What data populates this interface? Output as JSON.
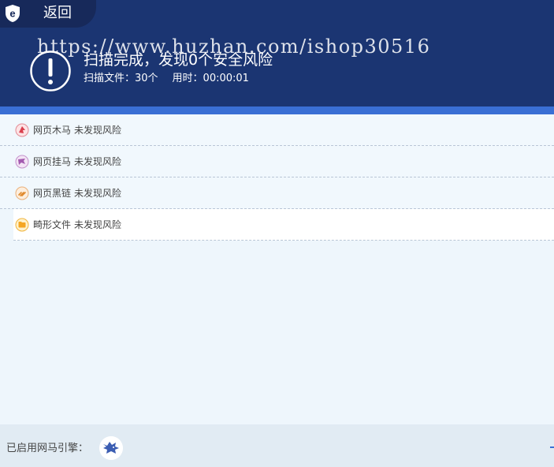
{
  "header": {
    "back_label": "返回",
    "watermark": "https://www.huzhan.com/ishop30516",
    "title": "扫描完成，发现0个安全风险",
    "files_label": "扫描文件：30个",
    "time_label": "用时：00:00:01"
  },
  "results": [
    {
      "name": "网页木马",
      "status": "未发现风险",
      "icon": "trojan-icon"
    },
    {
      "name": "网页挂马",
      "status": "未发现风险",
      "icon": "hanging-horse-icon"
    },
    {
      "name": "网页黑链",
      "status": "未发现风险",
      "icon": "black-link-icon"
    },
    {
      "name": "畸形文件",
      "status": "未发现风险",
      "icon": "malformed-file-icon"
    }
  ],
  "footer": {
    "engine_label": "已启用网马引擎："
  },
  "colors": {
    "header_bg": "#1b3572",
    "accent": "#3a6fd4",
    "body_bg": "#eef6fc"
  }
}
